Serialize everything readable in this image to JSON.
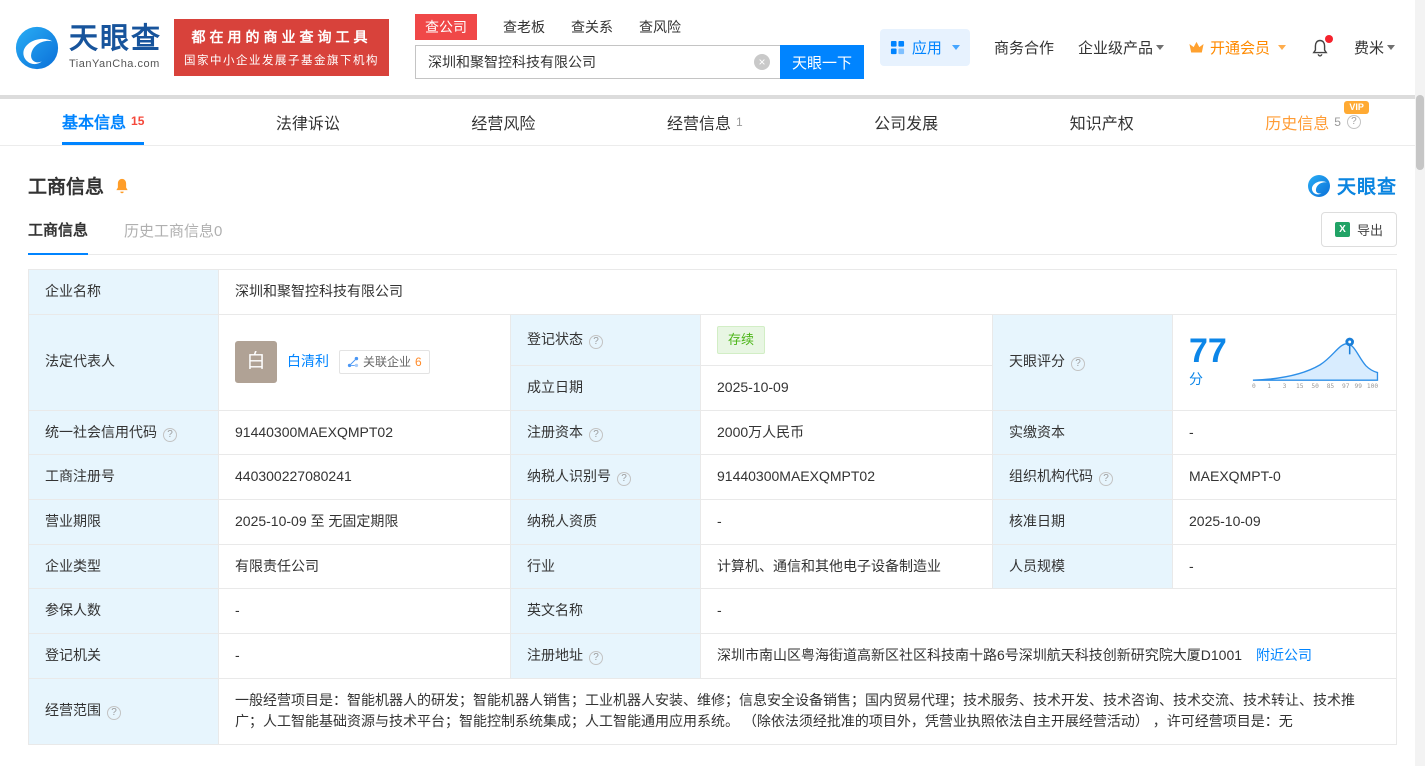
{
  "icons": {
    "help": "?",
    "clear": "×",
    "excel": "X"
  },
  "brand": {
    "logo_text": "天眼查",
    "logo_domain": "TianYanCha.com",
    "banner_line1": "都在用的商业查询工具",
    "banner_line2": "国家中小企业发展子基金旗下机构"
  },
  "search": {
    "tabs": [
      "查公司",
      "查老板",
      "查关系",
      "查风险"
    ],
    "value": "深圳和聚智控科技有限公司",
    "button_label": "天眼一下"
  },
  "header_right": {
    "apps_label": "应用",
    "cooperation_label": "商务合作",
    "enterprise_label": "企业级产品",
    "vip_label": "开通会员",
    "user_name": "费米"
  },
  "nav": {
    "tabs": [
      {
        "label": "基本信息",
        "count": "15"
      },
      {
        "label": "法律诉讼"
      },
      {
        "label": "经营风险"
      },
      {
        "label": "经营信息",
        "count": "1"
      },
      {
        "label": "公司发展"
      },
      {
        "label": "知识产权"
      },
      {
        "label": "历史信息",
        "count": "5",
        "vip": "VIP"
      }
    ]
  },
  "section": {
    "title": "工商信息",
    "watermark": "天眼查",
    "subtab_active": "工商信息",
    "subtab_history": "历史工商信息0",
    "export_label": "导出"
  },
  "table": {
    "company_name": {
      "label": "企业名称",
      "value": "深圳和聚智控科技有限公司"
    },
    "legal_rep": {
      "label": "法定代表人",
      "avatar": "白",
      "name": "白清利",
      "related_label": "关联企业",
      "related_count": "6"
    },
    "reg_status": {
      "label": "登记状态",
      "value": "存续"
    },
    "establish_date": {
      "label": "成立日期",
      "value": "2025-10-09"
    },
    "score": {
      "label": "天眼评分",
      "value": "77",
      "unit": "分",
      "axis": [
        "0",
        "1",
        "3",
        "15",
        "50",
        "85",
        "97",
        "99",
        "100"
      ]
    },
    "credit_code": {
      "label": "统一社会信用代码",
      "value": "91440300MAEXQMPT02"
    },
    "reg_capital": {
      "label": "注册资本",
      "value": "2000万人民币"
    },
    "paid_capital": {
      "label": "实缴资本",
      "value": "-"
    },
    "reg_number": {
      "label": "工商注册号",
      "value": "440300227080241"
    },
    "taxpayer_id": {
      "label": "纳税人识别号",
      "value": "91440300MAEXQMPT02"
    },
    "org_code": {
      "label": "组织机构代码",
      "value": "MAEXQMPT-0"
    },
    "business_term": {
      "label": "营业期限",
      "value": "2025-10-09 至 无固定期限"
    },
    "taxpayer_qualification": {
      "label": "纳税人资质",
      "value": "-"
    },
    "approval_date": {
      "label": "核准日期",
      "value": "2025-10-09"
    },
    "company_type": {
      "label": "企业类型",
      "value": "有限责任公司"
    },
    "industry": {
      "label": "行业",
      "value": "计算机、通信和其他电子设备制造业"
    },
    "staff_size": {
      "label": "人员规模",
      "value": "-"
    },
    "insured_count": {
      "label": "参保人数",
      "value": "-"
    },
    "english_name": {
      "label": "英文名称",
      "value": "-"
    },
    "reg_authority": {
      "label": "登记机关",
      "value": "-"
    },
    "reg_address": {
      "label": "注册地址",
      "value": "深圳市南山区粤海街道高新区社区科技南十路6号深圳航天科技创新研究院大厦D1001",
      "nearby_link": "附近公司"
    },
    "business_scope": {
      "label": "经营范围",
      "value": "一般经营项目是：智能机器人的研发；智能机器人销售；工业机器人安装、维修；信息安全设备销售；国内贸易代理；技术服务、技术开发、技术咨询、技术交流、技术转让、技术推广；人工智能基础资源与技术平台；智能控制系统集成；人工智能通用应用系统。 （除依法须经批准的项目外，凭营业执照依法自主开展经营活动） ，许可经营项目是：无"
    }
  }
}
